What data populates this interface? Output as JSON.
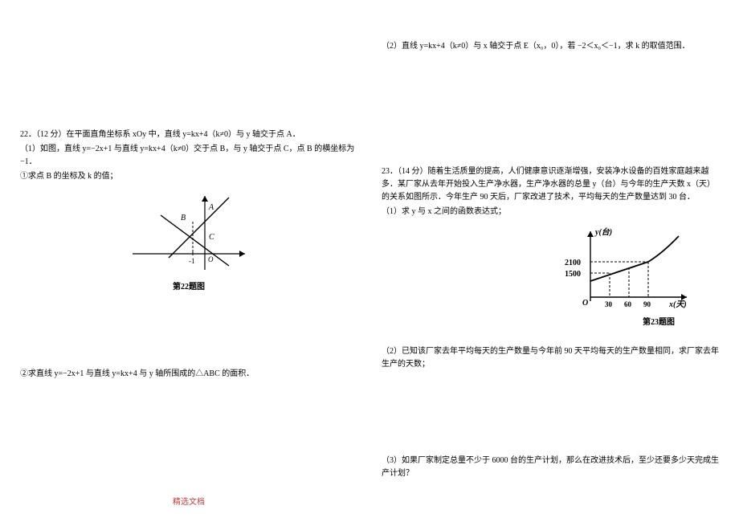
{
  "left": {
    "q22_header": "22．（12 分）在平面直角坐标系 xOy 中，直线 y=kx+4（k≠0）与 y 轴交于点 A．",
    "q22_1_intro": "（1）如图，直线 y=−2x+1 与直线 y=kx+4（k≠0）交于点 B，与 y 轴交于点 C，点 B 的横坐标为 −1．",
    "q22_1_sub1": "①求点 B 的坐标及 k 的值；",
    "fig22_labels": {
      "A": "A",
      "B": "B",
      "C": "C",
      "O": "O",
      "neg1": "-1"
    },
    "fig22_caption": "第22题图",
    "q22_1_sub2": "②求直线 y=−2x+1 与直线 y=kx+4 与 y 轴所围成的△ABC 的面积．"
  },
  "right": {
    "q22_2": "（2）直线 y=kx+4（k≠0）与 x 轴交于点 E（x₀，0），若 −2＜x₀＜−1，求 k 的取值范围．",
    "q23_header": "23．（14 分）随着生活质量的提高，人们健康意识逐渐增强，安装净水设备的百姓家庭越来越多．某厂家从去年开始投入生产净水器，生产净水器的总量 y（台）与今年的生产天数 x（天）的关系如图所示．今年生产 90 天后，厂家改进了技术，平均每天的生产数量达到 30 台．",
    "q23_1": "（1）求 y 与 x 之间的函数表达式；",
    "fig23_labels": {
      "y_axis": "y(台)",
      "x_axis": "x(天)",
      "y_2100": "2100",
      "y_1500": "1500",
      "x_30": "30",
      "x_60": "60",
      "x_90": "90",
      "O": "O"
    },
    "fig23_caption": "第23题图",
    "q23_2": "（2）已知该厂家去年平均每天的生产数量与今年前 90 天平均每天的生产数量相同，求厂家去年生产的天数；",
    "q23_3": "（3）如果厂家制定总量不少于 6000 台的生产计划，那么在改进技术后，至少还要多少天完成生产计划？"
  },
  "footer": "精选文档"
}
